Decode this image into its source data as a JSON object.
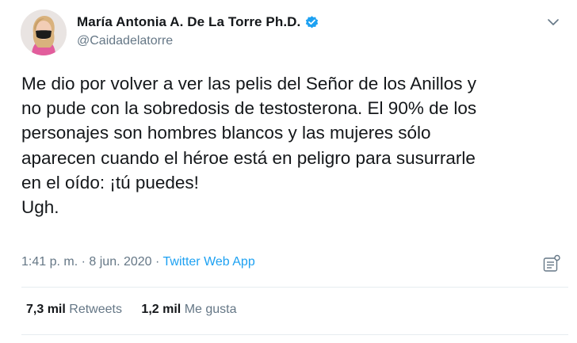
{
  "author": {
    "display_name": "María Antonia A. De La Torre Ph.D.",
    "handle": "@Caidadelatorre",
    "verified": true,
    "verified_color": "#1da1f2"
  },
  "tweet": {
    "lines": [
      "Me dio por volver a ver las pelis del Señor de los Anillos y",
      "no pude con la sobredosis de testosterona. El 90% de los",
      "personajes son hombres blancos y las mujeres sólo",
      "aparecen cuando el héroe está en peligro para susurrarle",
      "en el oído: ¡tú puedes!",
      "Ugh."
    ]
  },
  "meta": {
    "time": "1:41 p. m.",
    "separator": "·",
    "date": "8 jun. 2020",
    "source": "Twitter Web App"
  },
  "stats": {
    "retweets_count": "7,3 mil",
    "retweets_label": "Retweets",
    "likes_count": "1,2 mil",
    "likes_label": "Me gusta"
  },
  "icons": {
    "menu": "chevron-down-icon",
    "analytics": "analytics-icon",
    "verified": "verified-badge-icon"
  },
  "colors": {
    "text": "#14171a",
    "secondary": "#657786",
    "link": "#1da1f2",
    "divider": "#e6ecf0"
  }
}
